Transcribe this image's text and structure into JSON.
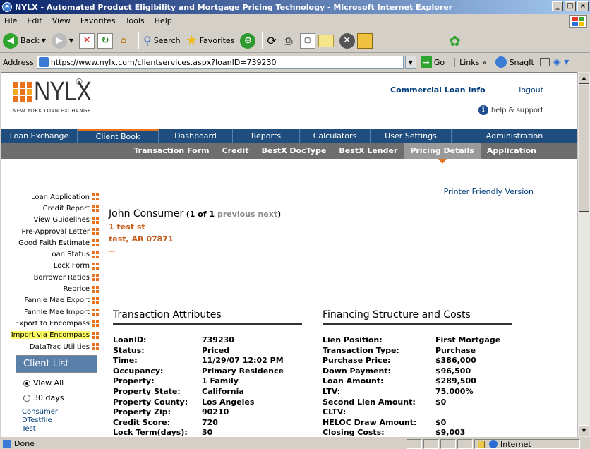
{
  "window": {
    "title": "NYLX - Automated Product Eligibility and Mortgage Pricing Technology - Microsoft Internet Explorer"
  },
  "menu": [
    "File",
    "Edit",
    "View",
    "Favorites",
    "Tools",
    "Help"
  ],
  "toolbar": {
    "back": "Back",
    "search": "Search",
    "favorites": "Favorites"
  },
  "address": {
    "label": "Address",
    "url": "https://www.nylx.com/clientservices.aspx?loanID=739230",
    "go": "Go",
    "links": "Links",
    "snagit": "SnagIt"
  },
  "status": {
    "text": "Done",
    "zone": "Internet"
  },
  "logo": {
    "wordmark": "NYLX",
    "reg": "®",
    "tagline": "NEW YORK LOAN EXCHANGE"
  },
  "header": {
    "commercial": "Commercial Loan Info",
    "logout": "logout",
    "help": "help & support"
  },
  "mainnav": [
    "Loan Exchange",
    "Client Book",
    "Dashboard",
    "Reports",
    "Calculators",
    "User Settings",
    "Administration"
  ],
  "subnav": [
    "Transaction Form",
    "Credit",
    "BestX DocType",
    "BestX Lender",
    "Pricing Details",
    "Application"
  ],
  "printer": "Printer Friendly Version",
  "sidemenu": [
    "Loan Application",
    "Credit Report",
    "View Guidelines",
    "Pre-Approval Letter",
    "Good Faith Estimate",
    "Loan Status",
    "Lock Form",
    "Borrower Ratios",
    "Reprice",
    "Fannie Mae Export",
    "Fannie Mae Import",
    "Export to Encompass",
    "Import via Encompass",
    "DataTrac Utilities"
  ],
  "consumer": {
    "name": "John Consumer",
    "of": "(1 of 1",
    "prev": "previous",
    "next": "next",
    "close": ")",
    "street": "1 test st",
    "city": "test, AR 07871",
    "dashes": "--"
  },
  "transaction": {
    "title": "Transaction Attributes",
    "rows": [
      [
        "LoanID:",
        "739230"
      ],
      [
        "Status:",
        "Priced"
      ],
      [
        "Time:",
        "11/29/07 12:02 PM"
      ],
      [
        "Occupancy:",
        "Primary Residence"
      ],
      [
        "Property:",
        "1 Family"
      ],
      [
        "Property State:",
        "California"
      ],
      [
        "Property County:",
        "Los Angeles"
      ],
      [
        "Property Zip:",
        "90210"
      ],
      [
        "Credit Score:",
        "720"
      ],
      [
        "Lock Term(days):",
        "30"
      ]
    ]
  },
  "financing": {
    "title": "Financing Structure and Costs",
    "rows": [
      [
        "Lien Position:",
        "First Mortgage"
      ],
      [
        "Transaction Type:",
        "Purchase"
      ],
      [
        "Purchase Price:",
        "$386,000"
      ],
      [
        "Down Payment:",
        "$96,500"
      ],
      [
        "Loan Amount:",
        "$289,500"
      ],
      [
        "LTV:",
        "75.000%"
      ],
      [
        "Second Lien Amount:",
        "$0"
      ],
      [
        "CLTV:",
        ""
      ],
      [
        "HELOC Draw Amount:",
        "$0"
      ],
      [
        "Closing Costs:",
        "$9,003"
      ]
    ]
  },
  "clientlist": {
    "title": "Client List",
    "opt1": "View All",
    "opt2": "30 days",
    "items": [
      "Consumer",
      "DTestfile",
      "Test"
    ]
  }
}
